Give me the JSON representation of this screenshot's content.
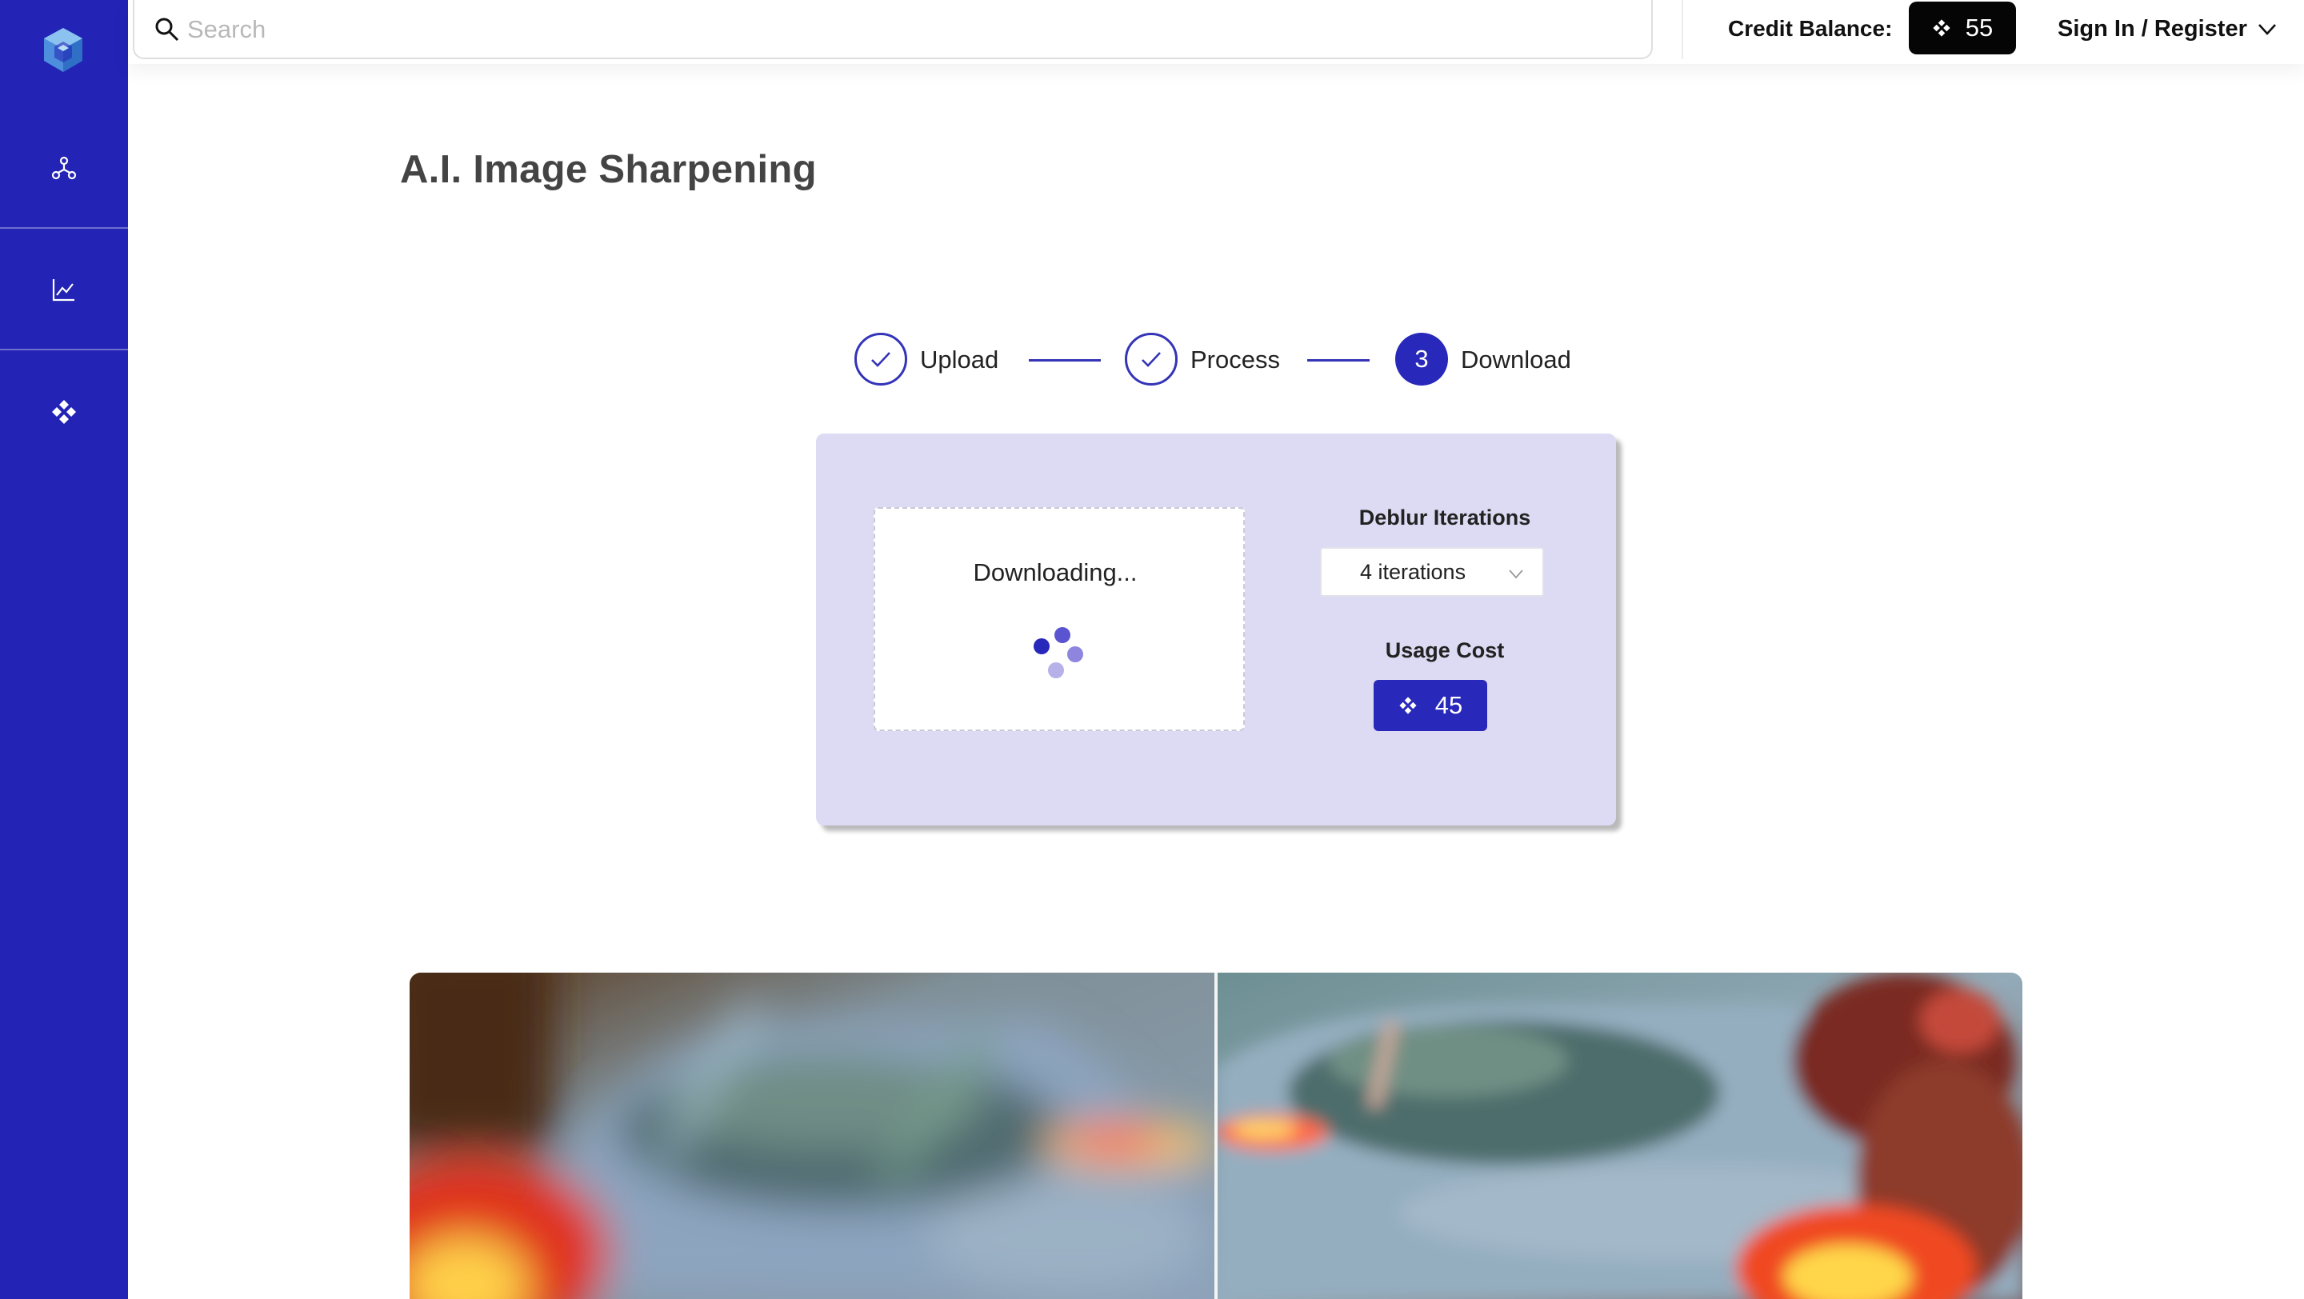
{
  "colors": {
    "brand": "#2323b6",
    "accent": "#2828ba",
    "card_bg": "#dddaf3",
    "credit_pill_bg": "#050505"
  },
  "sidebar": {
    "logo": "cube-logo-icon",
    "items": [
      {
        "name": "network-icon"
      },
      {
        "name": "line-chart-icon"
      },
      {
        "name": "credits-diamond-icon"
      }
    ]
  },
  "header": {
    "search": {
      "placeholder": "Search",
      "value": ""
    },
    "credit_label": "Credit Balance:",
    "credit_value": "55",
    "signin_label": "Sign In / Register"
  },
  "main": {
    "title": "A.I. Image Sharpening",
    "steps": [
      {
        "label": "Upload",
        "state": "done"
      },
      {
        "label": "Process",
        "state": "done"
      },
      {
        "label": "Download",
        "state": "active",
        "number": "3"
      }
    ],
    "card": {
      "status_text": "Downloading...",
      "iterations_label": "Deblur Iterations",
      "iterations_value": "4 iterations",
      "cost_label": "Usage Cost",
      "cost_value": "45"
    }
  }
}
